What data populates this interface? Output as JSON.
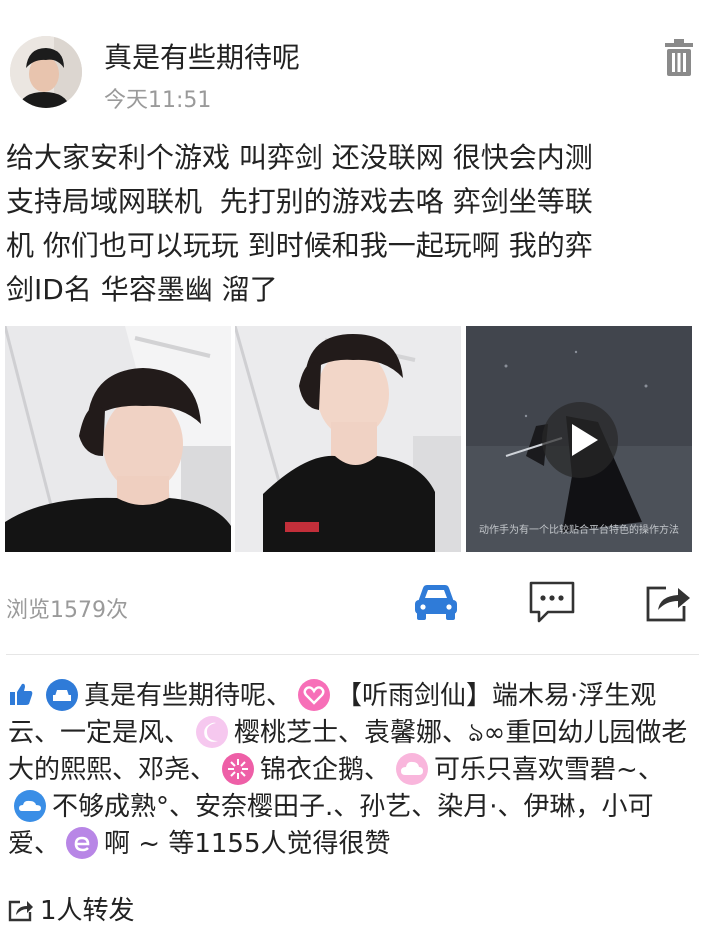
{
  "post": {
    "author": "真是有些期待呢",
    "time": "今天11:51",
    "text": "给大家安利个游戏 叫弈剑 还没联网 很快会内测\n支持局域网联机  先打别的游戏去咯 弈剑坐等联\n机 你们也可以玩玩 到时候和我一起玩啊 我的弈\n剑ID名 华容墨幽 溜了",
    "video_caption": "动作手为有一个比较贴合平台特色的操作方法"
  },
  "stats": {
    "views": "浏览1579次"
  },
  "icons": {
    "delete": "trash-icon",
    "like_car": "car-icon",
    "comment": "comment-icon",
    "share": "share-icon",
    "like_thumb": "thumbs-up-icon",
    "repost": "repost-icon",
    "play": "play-icon"
  },
  "colors": {
    "accent": "#2f7bd8",
    "text": "#222222",
    "muted": "#9a9a9a"
  },
  "likes": {
    "user1": "真是有些期待呢、",
    "user2": "【听雨剑仙】端木易·浮生观云、一定是风、",
    "user3": "樱桃芝士、袁馨娜、",
    "user4": "ঌ∞重回幼儿园做老大的熙熙、邓尧、",
    "user5": "锦衣企鹅、",
    "user6": "可乐只喜欢雪碧~、",
    "user7": "不够成熟°、安奈樱田子.、孙艺、染月·、伊琳，小可爱、",
    "user8": "啊 ~ 等1155人觉得很赞"
  },
  "repost": {
    "label": "1人转发"
  }
}
